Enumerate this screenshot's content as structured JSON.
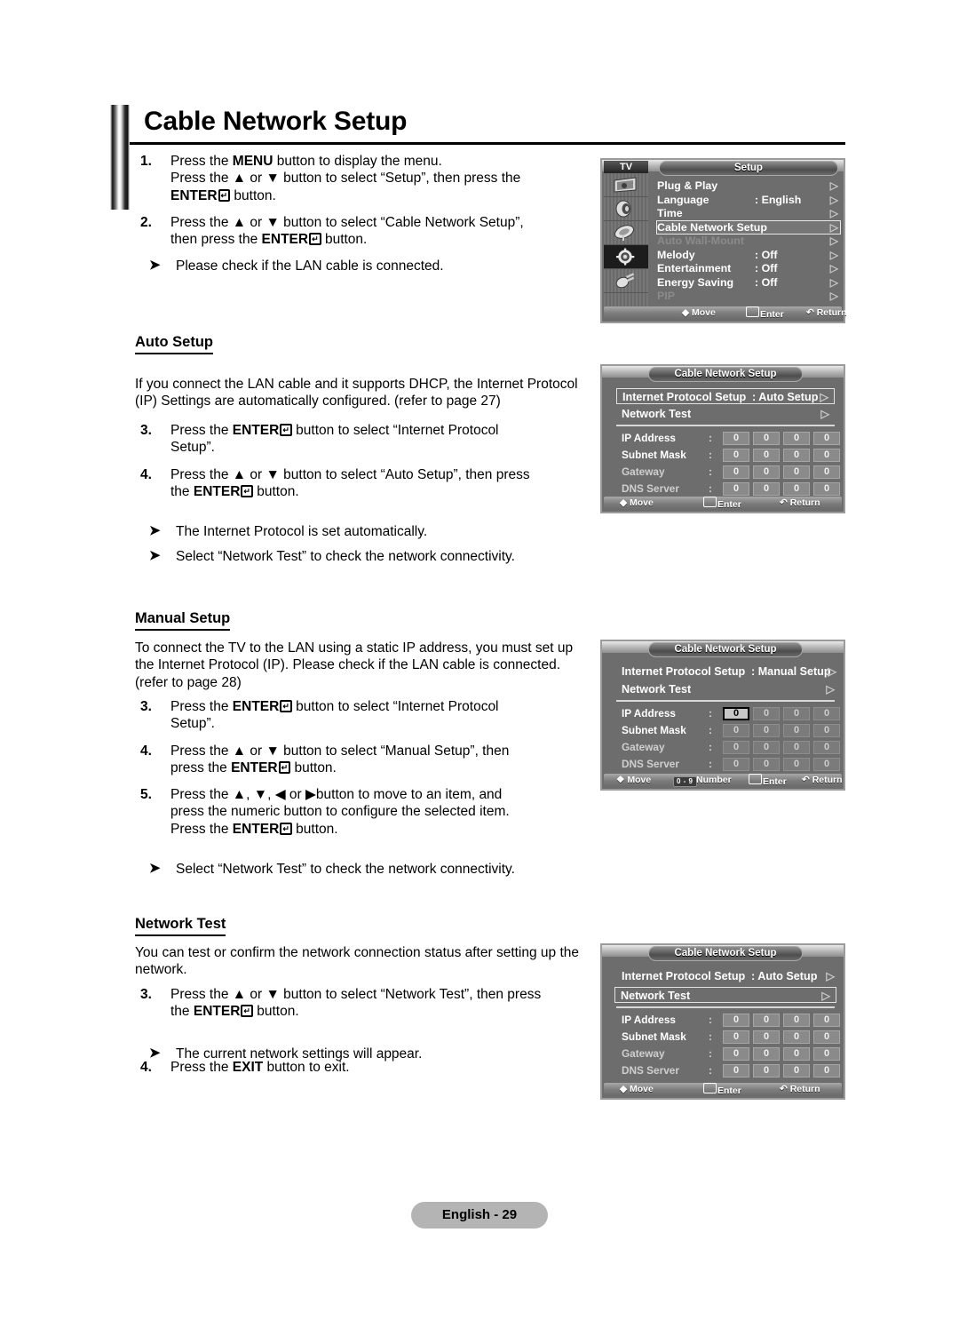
{
  "page": {
    "title": "Cable Network Setup",
    "footer_label": "English - 29"
  },
  "intro_steps": [
    {
      "num": "1.",
      "lines": [
        "Press the MENU button to display the menu.",
        "Press the ▲ or ▼ button to select “Setup”, then press the",
        "ENTER↵ button."
      ]
    },
    {
      "num": "2.",
      "lines": [
        "Press the ▲ or ▼ button to select “Cable Network Setup”,",
        "then press the ENTER↵ button."
      ]
    }
  ],
  "intro_note": "Please check if the LAN cable is connected.",
  "auto_setup": {
    "heading": "Auto Setup",
    "body": "If you connect the LAN cable and it supports DHCP, the Internet Protocol (IP) Settings are automatically configured. (refer to page 27)",
    "steps": [
      {
        "num": "3.",
        "lines": [
          "Press the ENTER↵ button to select “Internet Protocol",
          "Setup”."
        ]
      },
      {
        "num": "4.",
        "lines": [
          "Press the ▲ or ▼ button to select “Auto Setup”, then press",
          "the ENTER↵ button."
        ]
      }
    ],
    "notes": [
      "The Internet Protocol is set automatically.",
      "Select “Network Test” to check the network connectivity."
    ]
  },
  "manual_setup": {
    "heading": "Manual Setup",
    "body": "To connect the TV to the LAN using a static IP address, you must set up the Internet Protocol (IP). Please check if the LAN cable is connected. (refer to page 28)",
    "steps": [
      {
        "num": "3.",
        "lines": [
          "Press the ENTER↵ button to select “Internet Protocol",
          "Setup”."
        ]
      },
      {
        "num": "4.",
        "lines": [
          "Press the ▲ or ▼ button to select “Manual Setup”, then",
          "press the ENTER↵ button."
        ]
      },
      {
        "num": "5.",
        "lines": [
          "Press the ▲, ▼, ◀ or ▶button to move to an item, and",
          "press the numeric button to configure the selected item.",
          "Press the ENTER↵ button."
        ]
      }
    ],
    "notes": [
      "Select “Network Test” to check the network connectivity."
    ]
  },
  "network_test": {
    "heading": "Network Test",
    "body": "You can test or confirm the network connection status after setting up the network.",
    "steps": [
      {
        "num": "3.",
        "lines": [
          "Press the ▲ or ▼ button to select “Network Test”, then press",
          "the ENTER↵ button."
        ]
      }
    ],
    "notes": [
      "The current network settings will appear."
    ],
    "final_step": {
      "num": "4.",
      "text": "Press the EXIT button to exit."
    }
  },
  "osd_setup": {
    "tv_tag": "TV",
    "title": "Setup",
    "side_icons": [
      "picture-icon",
      "sound-icon",
      "channel-icon",
      "setup-gear-icon",
      "input-icon"
    ],
    "rows": [
      {
        "label": "Plug & Play",
        "value": "",
        "state": "normal",
        "arrow": "▷"
      },
      {
        "label": "Language",
        "value": ": English",
        "state": "normal",
        "arrow": "▷"
      },
      {
        "label": "Time",
        "value": "",
        "state": "normal",
        "arrow": "▷"
      },
      {
        "label": "Cable Network Setup",
        "value": "",
        "state": "selected",
        "arrow": "▷"
      },
      {
        "label": "Auto Wall-Mount",
        "value": "",
        "state": "dim",
        "arrow": "▷"
      },
      {
        "label": "Melody",
        "value": ": Off",
        "state": "normal",
        "arrow": "▷"
      },
      {
        "label": "Entertainment",
        "value": ": Off",
        "state": "normal",
        "arrow": "▷"
      },
      {
        "label": "Energy Saving",
        "value": ": Off",
        "state": "normal",
        "arrow": "▷"
      },
      {
        "label": "PIP",
        "value": "",
        "state": "dim",
        "arrow": "▷"
      }
    ],
    "bottom": {
      "move": "Move",
      "enter": "Enter",
      "return": "Return"
    }
  },
  "osd_auto": {
    "title": "Cable Network Setup",
    "protocol_row": {
      "label": "Internet Protocol Setup",
      "value": ": Auto Setup",
      "arrow": "▷",
      "selected": true
    },
    "test_row": {
      "label": "Network Test",
      "arrow": "▷",
      "selected": false
    },
    "fields": [
      {
        "label": "IP Address",
        "colon": ":",
        "values": [
          "0",
          "0",
          "0",
          "0"
        ],
        "focus": -1
      },
      {
        "label": "Subnet Mask",
        "colon": ":",
        "values": [
          "0",
          "0",
          "0",
          "0"
        ],
        "focus": -1
      },
      {
        "label": "Gateway",
        "colon": ":",
        "values": [
          "0",
          "0",
          "0",
          "0"
        ],
        "focus": -1
      },
      {
        "label": "DNS Server",
        "colon": ":",
        "values": [
          "0",
          "0",
          "0",
          "0"
        ],
        "focus": -1
      }
    ],
    "bottom": {
      "move": "Move",
      "enter": "Enter",
      "return": "Return"
    }
  },
  "osd_manual": {
    "title": "Cable Network Setup",
    "protocol_row": {
      "label": "Internet Protocol Setup",
      "value": ": Manual Setup",
      "arrow": "▷",
      "selected": false
    },
    "test_row": {
      "label": "Network Test",
      "arrow": "▷",
      "selected": false
    },
    "fields": [
      {
        "label": "IP Address",
        "colon": ":",
        "values": [
          "0",
          "0",
          "0",
          "0"
        ],
        "focus": 0
      },
      {
        "label": "Subnet Mask",
        "colon": ":",
        "values": [
          "0",
          "0",
          "0",
          "0"
        ],
        "focus": -1
      },
      {
        "label": "Gateway",
        "colon": ":",
        "values": [
          "0",
          "0",
          "0",
          "0"
        ],
        "focus": -1
      },
      {
        "label": "DNS Server",
        "colon": ":",
        "values": [
          "0",
          "0",
          "0",
          "0"
        ],
        "focus": -1
      }
    ],
    "bottom": {
      "move": "Move",
      "number_chip": "0 - 9",
      "number": "Number",
      "enter": "Enter",
      "return": "Return"
    }
  },
  "osd_test": {
    "title": "Cable Network Setup",
    "protocol_row": {
      "label": "Internet Protocol Setup",
      "value": ": Auto Setup",
      "arrow": "▷",
      "selected": false
    },
    "test_row": {
      "label": "Network Test",
      "arrow": "▷",
      "selected": true
    },
    "fields": [
      {
        "label": "IP Address",
        "colon": ":",
        "values": [
          "0",
          "0",
          "0",
          "0"
        ],
        "focus": -1
      },
      {
        "label": "Subnet Mask",
        "colon": ":",
        "values": [
          "0",
          "0",
          "0",
          "0"
        ],
        "focus": -1
      },
      {
        "label": "Gateway",
        "colon": ":",
        "values": [
          "0",
          "0",
          "0",
          "0"
        ],
        "focus": -1
      },
      {
        "label": "DNS Server",
        "colon": ":",
        "values": [
          "0",
          "0",
          "0",
          "0"
        ],
        "focus": -1
      }
    ],
    "bottom": {
      "move": "Move",
      "enter": "Enter",
      "return": "Return"
    }
  }
}
